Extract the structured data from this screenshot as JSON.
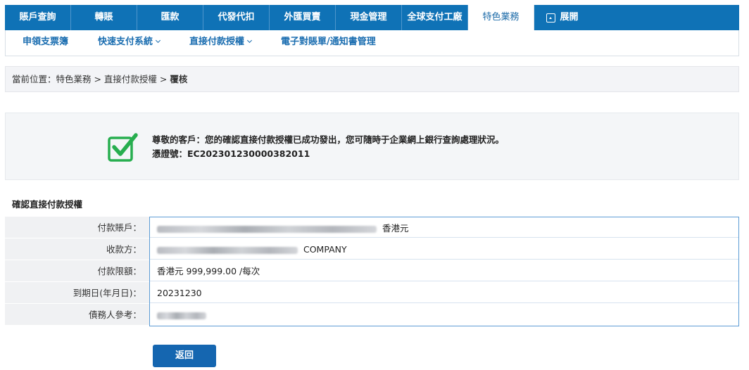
{
  "top_nav": {
    "tabs": [
      {
        "label": "賬戶查詢"
      },
      {
        "label": "轉賬"
      },
      {
        "label": "匯款"
      },
      {
        "label": "代發代扣"
      },
      {
        "label": "外匯買賣"
      },
      {
        "label": "現金管理"
      },
      {
        "label": "全球支付工廠"
      },
      {
        "label": "特色業務"
      },
      {
        "label": "展開"
      }
    ],
    "active_tab": "特色業務"
  },
  "sub_nav": {
    "items": [
      {
        "label": "申領支票簿"
      },
      {
        "label": "快速支付系統"
      },
      {
        "label": "直接付款授權"
      },
      {
        "label": "電子對賬單/通知書管理"
      }
    ]
  },
  "breadcrumb": {
    "prefix": "當前位置：特色業務 > 直接付款授權 > ",
    "current": "覆核"
  },
  "success": {
    "message": "尊敬的客戶：您的確認直接付款授權已成功發出，您可隨時于企業網上銀行查詢處理狀況。",
    "reference": "憑證號：EC202301230000382011"
  },
  "section_title": "確認直接付款授權",
  "form": {
    "rows": [
      {
        "label": "付款賬戶：",
        "value_suffix": "香港元"
      },
      {
        "label": "收款方：",
        "value_suffix": "COMPANY"
      },
      {
        "label": "付款限額：",
        "value": "香港元 999,999.00 /每次"
      },
      {
        "label": "到期日(年月日)：",
        "value": "20231230"
      },
      {
        "label": "債務人參考：",
        "value": ""
      }
    ]
  },
  "buttons": {
    "back": "返回"
  },
  "colors": {
    "primary": "#0f72b6",
    "success_green": "#27ae4f",
    "border_blue": "#5b9bd5"
  }
}
